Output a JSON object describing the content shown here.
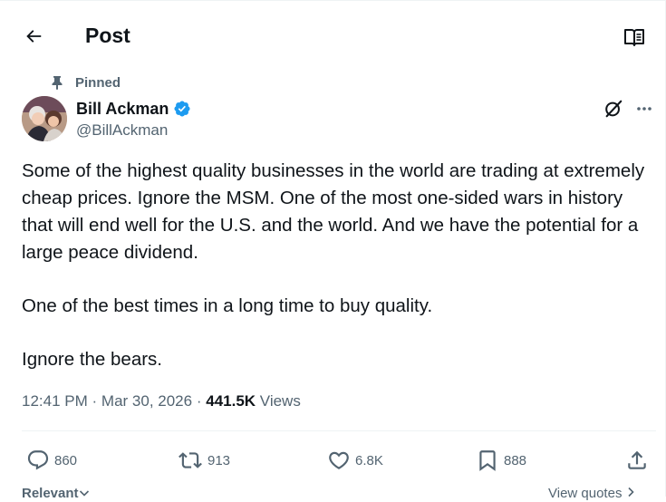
{
  "header": {
    "title": "Post"
  },
  "post": {
    "pinned_label": "Pinned",
    "author": {
      "name": "Bill Ackman",
      "handle": "@BillAckman",
      "verified": true,
      "verified_color": "#1d9bf0"
    },
    "paragraphs": [
      "Some of the highest quality businesses in the world are trading at extremely cheap prices. Ignore the MSM. One of the most one-sided wars in history that will end well for the U.S. and the world. And we have the potential for a large peace dividend.",
      "One of the best times in a long time to buy quality.",
      "Ignore the bears."
    ],
    "time": "12:41 PM",
    "date": "Mar 30, 2026",
    "separator": "·",
    "views_count": "441.5K",
    "views_label": "Views"
  },
  "actions": {
    "replies": "860",
    "reposts": "913",
    "likes": "6.8K",
    "bookmarks": "888"
  },
  "footer": {
    "sort_label": "Relevant",
    "view_quotes_label": "View quotes"
  },
  "colors": {
    "text_primary": "#0f1419",
    "text_secondary": "#536471",
    "accent": "#1d9bf0"
  }
}
